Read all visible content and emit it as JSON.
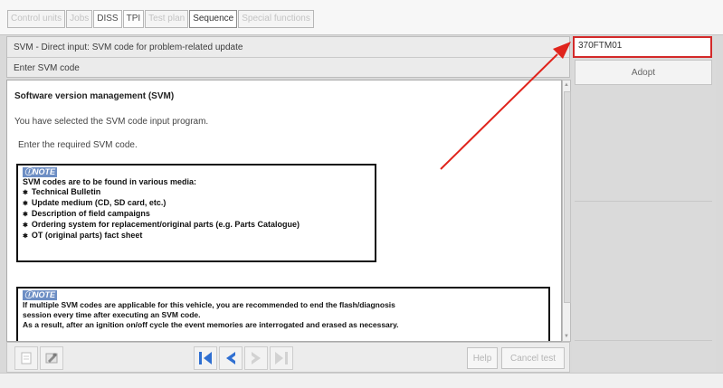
{
  "tabs": [
    "Control units",
    "Jobs",
    "DISS",
    "TPI",
    "Test plan",
    "Sequence",
    "Special functions"
  ],
  "header": {
    "title": "SVM - Direct input: SVM code for problem-related update",
    "subtitle": "Enter SVM code"
  },
  "content": {
    "title": "Software version management (SVM)",
    "p1": "You have selected the SVM code input program.",
    "p2": "Enter the required SVM code.",
    "note1": {
      "label": "NOTE",
      "intro": "SVM codes are to be found in various media:",
      "items": [
        "Technical Bulletin",
        "Update medium (CD, SD card, etc.)",
        "Description of field campaigns",
        "Ordering system for replacement/original parts (e.g. Parts Catalogue)",
        "OT (original parts) fact sheet"
      ]
    },
    "note2": {
      "label": "NOTE",
      "line1": "If multiple SVM codes are applicable for this vehicle, you are recommended to end the flash/diagnosis",
      "line2": "session every time after executing an SVM code.",
      "line3": "As a result, after an ignition on/off cycle the event memories are interrogated and erased as necessary."
    }
  },
  "right_panel": {
    "svm_code_value": "370FTM01",
    "accept_label": "Adopt"
  },
  "footer": {
    "help_label": "Help",
    "cancel_label": "Cancel test"
  },
  "colors": {
    "highlight": "#d32a2a",
    "arrow": "#e0241c",
    "nav_blue": "#2f6fd1",
    "note_header": "#6d8ec4"
  },
  "icons": {
    "first": "skip-to-first-icon",
    "prev": "previous-icon",
    "next": "next-icon",
    "last": "skip-to-last-icon",
    "print": "print-icon",
    "tools": "tools-icon"
  }
}
